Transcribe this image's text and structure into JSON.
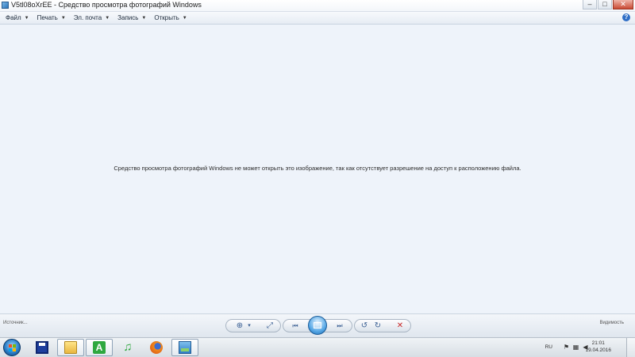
{
  "window": {
    "title": "V5tl08oXrEE - Средство просмотра фотографий Windows",
    "minimize_glyph": "–",
    "maximize_glyph": "□",
    "close_glyph": "✕"
  },
  "menu": {
    "items": [
      {
        "label": "Файл"
      },
      {
        "label": "Печать"
      },
      {
        "label": "Эл. почта"
      },
      {
        "label": "Запись"
      },
      {
        "label": "Открыть"
      }
    ],
    "help_glyph": "?"
  },
  "main": {
    "error_message": "Средство просмотра фотографий Windows не может открыть это изображение, так как отсутствует разрешение на доступ к расположению файла."
  },
  "controls": {
    "left_label": "Источник...",
    "right_label": "Видимость",
    "zoom_glyph": "⊕",
    "zoom_caret": "▾",
    "fit_glyph": "⤢",
    "prev_glyph": "⏮",
    "next_glyph": "⏭",
    "rotate_ccw_glyph": "↺",
    "rotate_cw_glyph": "↻",
    "delete_glyph": "✕",
    "colors": {
      "delete": "#c92a2a",
      "nav": "#3a6fb5"
    }
  },
  "taskbar": {
    "language": "RU",
    "time": "21:01",
    "date": "19.04.2016",
    "tray_icons": [
      "flag-icon",
      "network-icon",
      "volume-icon"
    ],
    "apps": [
      {
        "name": "save-icon"
      },
      {
        "name": "folder-icon"
      },
      {
        "name": "a-app-icon",
        "glyph": "A"
      },
      {
        "name": "music-note-icon",
        "glyph": "♫"
      },
      {
        "name": "firefox-icon"
      },
      {
        "name": "photo-viewer-icon"
      }
    ]
  }
}
